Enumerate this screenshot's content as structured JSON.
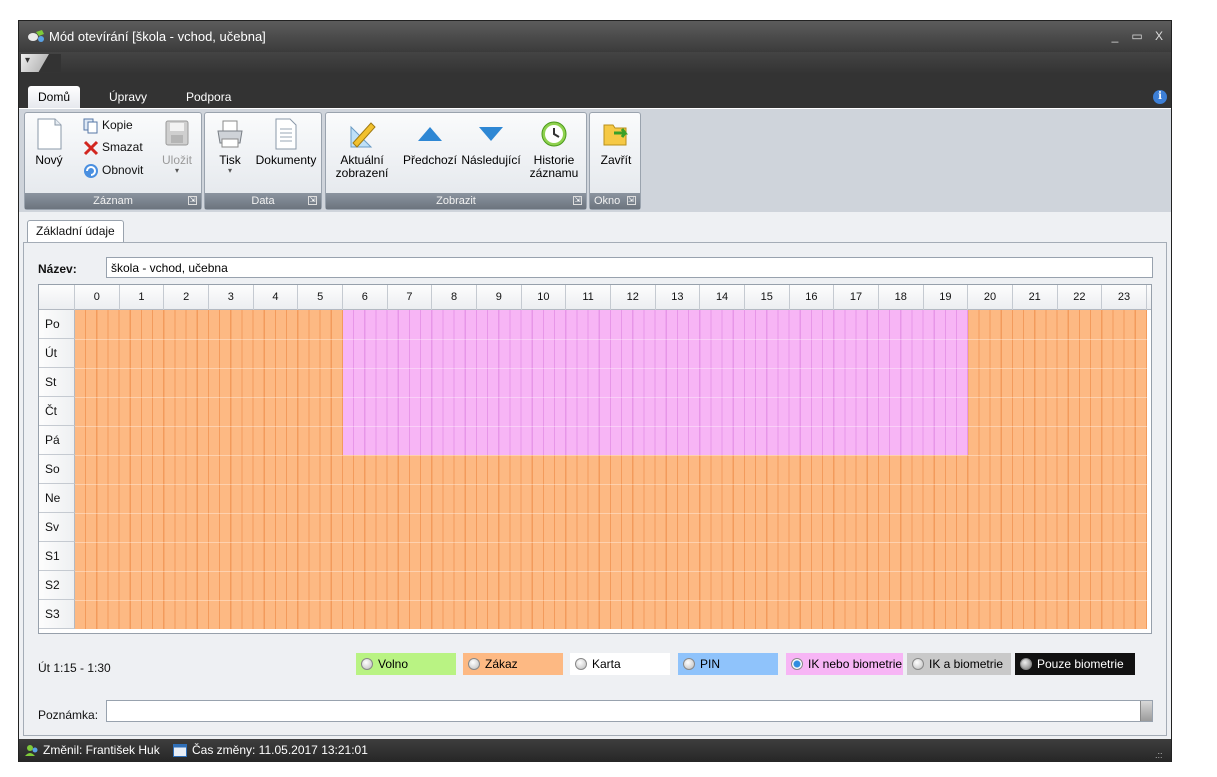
{
  "window": {
    "title": "Mód otevírání [škola - vchod, učebna]",
    "controls": {
      "minimize": "_",
      "maximize": "▭",
      "close": "X"
    }
  },
  "quick_access": {
    "label": "▾"
  },
  "ribbon_tabs": [
    "Domů",
    "Úpravy",
    "Podpora"
  ],
  "ribbon": {
    "zaznam": {
      "caption": "Záznam",
      "novy": "Nový",
      "kopie": "Kopie",
      "smazat": "Smazat",
      "obnovit": "Obnovit",
      "ulozit": "Uložit"
    },
    "data": {
      "caption": "Data",
      "tisk": "Tisk",
      "dokumenty": "Dokumenty"
    },
    "zobrazit": {
      "caption": "Zobrazit",
      "aktualni_1": "Aktuální",
      "aktualni_2": "zobrazení",
      "predchozi": "Předchozí",
      "nasledujici": "Následující",
      "historie_1": "Historie",
      "historie_2": "záznamu"
    },
    "okno": {
      "caption": "Okno",
      "zavrit": "Zavřít"
    },
    "launcher_glyph": "⇲"
  },
  "document_tab": "Základní údaje",
  "form": {
    "name_label": "Název:",
    "name_value": "škola - vchod, učebna",
    "note_label": "Poznámka:",
    "note_value": ""
  },
  "grid": {
    "hours": [
      "0",
      "1",
      "2",
      "3",
      "4",
      "5",
      "6",
      "7",
      "8",
      "9",
      "10",
      "11",
      "12",
      "13",
      "14",
      "15",
      "16",
      "17",
      "18",
      "19",
      "20",
      "21",
      "22",
      "23"
    ],
    "days": [
      "Po",
      "Út",
      "St",
      "Čt",
      "Pá",
      "So",
      "Ne",
      "Sv",
      "S1",
      "S2",
      "S3"
    ],
    "slots_per_hour": 4,
    "default_mode": "Zákaz",
    "rules": [
      {
        "days": [
          "Po",
          "Út",
          "St",
          "Čt",
          "Pá"
        ],
        "from": "6:00",
        "to": "20:00",
        "mode": "IK nebo biometrie"
      }
    ]
  },
  "hover_status": "Út 1:15 - 1:30",
  "legend": [
    {
      "label": "Volno",
      "color": "#b9f383",
      "text_color": "#000000"
    },
    {
      "label": "Zákaz",
      "color": "#fdb983",
      "text_color": "#000000"
    },
    {
      "label": "Karta",
      "color": "#ffffff",
      "text_color": "#000000"
    },
    {
      "label": "PIN",
      "color": "#8fc3fb",
      "text_color": "#000000"
    },
    {
      "label": "IK nebo biometrie",
      "color": "#f7b5f5",
      "text_color": "#000000",
      "selected": true
    },
    {
      "label": "IK a biometrie",
      "color": "#c9c9c9",
      "text_color": "#000000"
    },
    {
      "label": "Pouze biometrie",
      "color": "#111111",
      "text_color": "#ffffff"
    }
  ],
  "statusbar": {
    "changed_by": "Změnil: František Huk",
    "changed_at": "Čas změny: 11.05.2017 13:21:01",
    "grip": ".::"
  }
}
